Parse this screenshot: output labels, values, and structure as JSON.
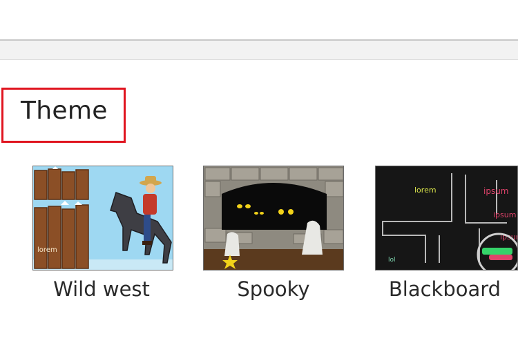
{
  "section": {
    "title": "Theme"
  },
  "themes": [
    {
      "label": "Wild west",
      "thumb_text": "lorem"
    },
    {
      "label": "Spooky"
    },
    {
      "label": "Blackboard",
      "thumb_texts": [
        "lorem",
        "ipsum",
        "ipsum",
        "ipsum",
        "lol"
      ]
    }
  ],
  "colors": {
    "highlight_border": "#e0141f",
    "thumb_border": "#6b6b6b",
    "top_bar": "#f2f2f2"
  }
}
